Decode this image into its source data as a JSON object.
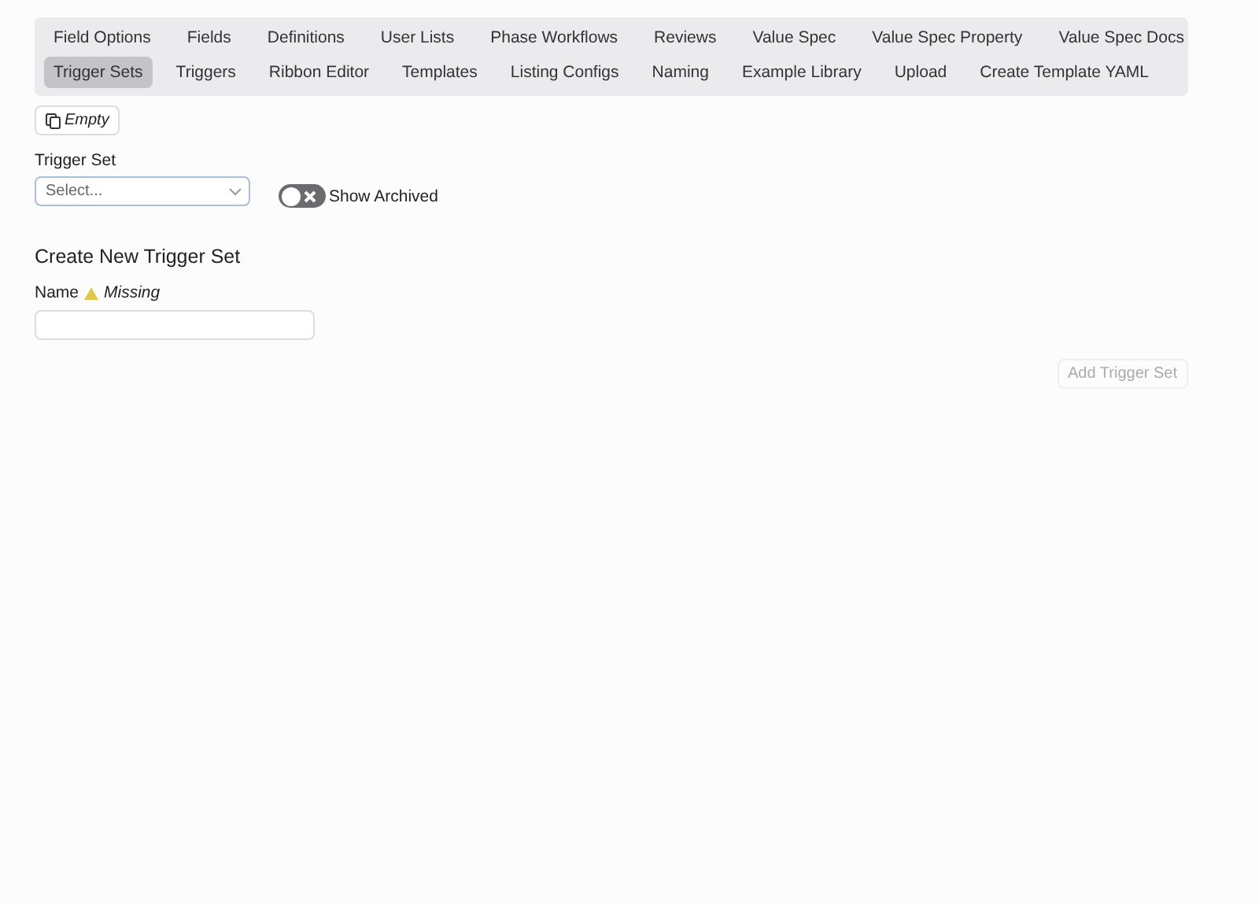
{
  "tabs": [
    [
      {
        "label": "Field Options",
        "selected": false
      },
      {
        "label": "Fields",
        "selected": false
      },
      {
        "label": "Definitions",
        "selected": false
      },
      {
        "label": "User Lists",
        "selected": false
      },
      {
        "label": "Phase Workflows",
        "selected": false
      },
      {
        "label": "Reviews",
        "selected": false
      },
      {
        "label": "Value Spec",
        "selected": false
      },
      {
        "label": "Value Spec Property",
        "selected": false
      },
      {
        "label": "Value Spec Docs",
        "selected": false
      }
    ],
    [
      {
        "label": "Trigger Sets",
        "selected": true
      },
      {
        "label": "Triggers",
        "selected": false
      },
      {
        "label": "Ribbon Editor",
        "selected": false
      },
      {
        "label": "Templates",
        "selected": false
      },
      {
        "label": "Listing Configs",
        "selected": false
      },
      {
        "label": "Naming",
        "selected": false
      },
      {
        "label": "Example Library",
        "selected": false
      },
      {
        "label": "Upload",
        "selected": false
      },
      {
        "label": "Create Template YAML",
        "selected": false
      }
    ]
  ],
  "copy_button": {
    "label": "Empty"
  },
  "trigger_set": {
    "label": "Trigger Set",
    "placeholder": "Select..."
  },
  "show_archived": {
    "label": "Show Archived",
    "on": false
  },
  "create": {
    "heading": "Create New Trigger Set",
    "name_label": "Name",
    "warning": "Missing",
    "add_button": {
      "label": "Add Trigger Set",
      "disabled": true
    }
  }
}
